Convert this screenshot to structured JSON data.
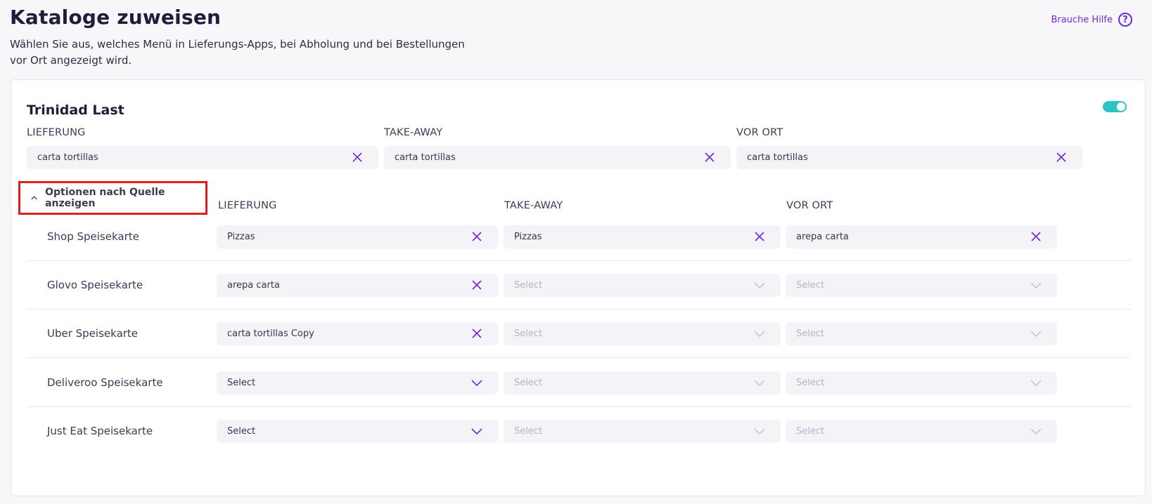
{
  "header": {
    "title": "Kataloge zuweisen",
    "subtitle": "Wählen Sie aus, welches Menü in Lieferungs-Apps, bei Abholung und bei Bestellungen vor Ort angezeigt wird.",
    "help_label": "Brauche Hilfe",
    "help_icon": "question-circle-icon"
  },
  "colors": {
    "accent": "#6c2bd9",
    "toggle_on": "#2ec4c4",
    "highlight_border": "#e02020"
  },
  "store": {
    "name": "Trinidad Last",
    "enabled": true,
    "columns": [
      "LIEFERUNG",
      "TAKE-AWAY",
      "VOR ORT"
    ],
    "defaults": [
      {
        "value": "carta tortillas",
        "icon": "close-x-icon"
      },
      {
        "value": "carta tortillas",
        "icon": "close-x-icon"
      },
      {
        "value": "carta tortillas",
        "icon": "close-x-icon"
      }
    ]
  },
  "source_options": {
    "toggle_label": "Optionen nach Quelle anzeigen",
    "toggle_icon": "chevron-up-icon",
    "columns": [
      "LIEFERUNG",
      "TAKE-AWAY",
      "VOR ORT"
    ],
    "rows": [
      {
        "label": "Shop Speisekarte",
        "cells": [
          {
            "value": "Pizzas",
            "selected": true
          },
          {
            "value": "Pizzas",
            "selected": true
          },
          {
            "value": "arepa carta",
            "selected": true
          }
        ]
      },
      {
        "label": "Glovo Speisekarte",
        "cells": [
          {
            "value": "arepa carta",
            "selected": true
          },
          {
            "value": "Select",
            "selected": false,
            "disabled": true
          },
          {
            "value": "Select",
            "selected": false,
            "disabled": true
          }
        ]
      },
      {
        "label": "Uber Speisekarte",
        "cells": [
          {
            "value": "carta tortillas Copy",
            "selected": true
          },
          {
            "value": "Select",
            "selected": false,
            "disabled": true
          },
          {
            "value": "Select",
            "selected": false,
            "disabled": true
          }
        ]
      },
      {
        "label": "Deliveroo Speisekarte",
        "cells": [
          {
            "value": "Select",
            "selected": false
          },
          {
            "value": "Select",
            "selected": false,
            "disabled": true
          },
          {
            "value": "Select",
            "selected": false,
            "disabled": true
          }
        ]
      },
      {
        "label": "Just Eat Speisekarte",
        "cells": [
          {
            "value": "Select",
            "selected": false
          },
          {
            "value": "Select",
            "selected": false,
            "disabled": true
          },
          {
            "value": "Select",
            "selected": false,
            "disabled": true
          }
        ]
      }
    ]
  }
}
